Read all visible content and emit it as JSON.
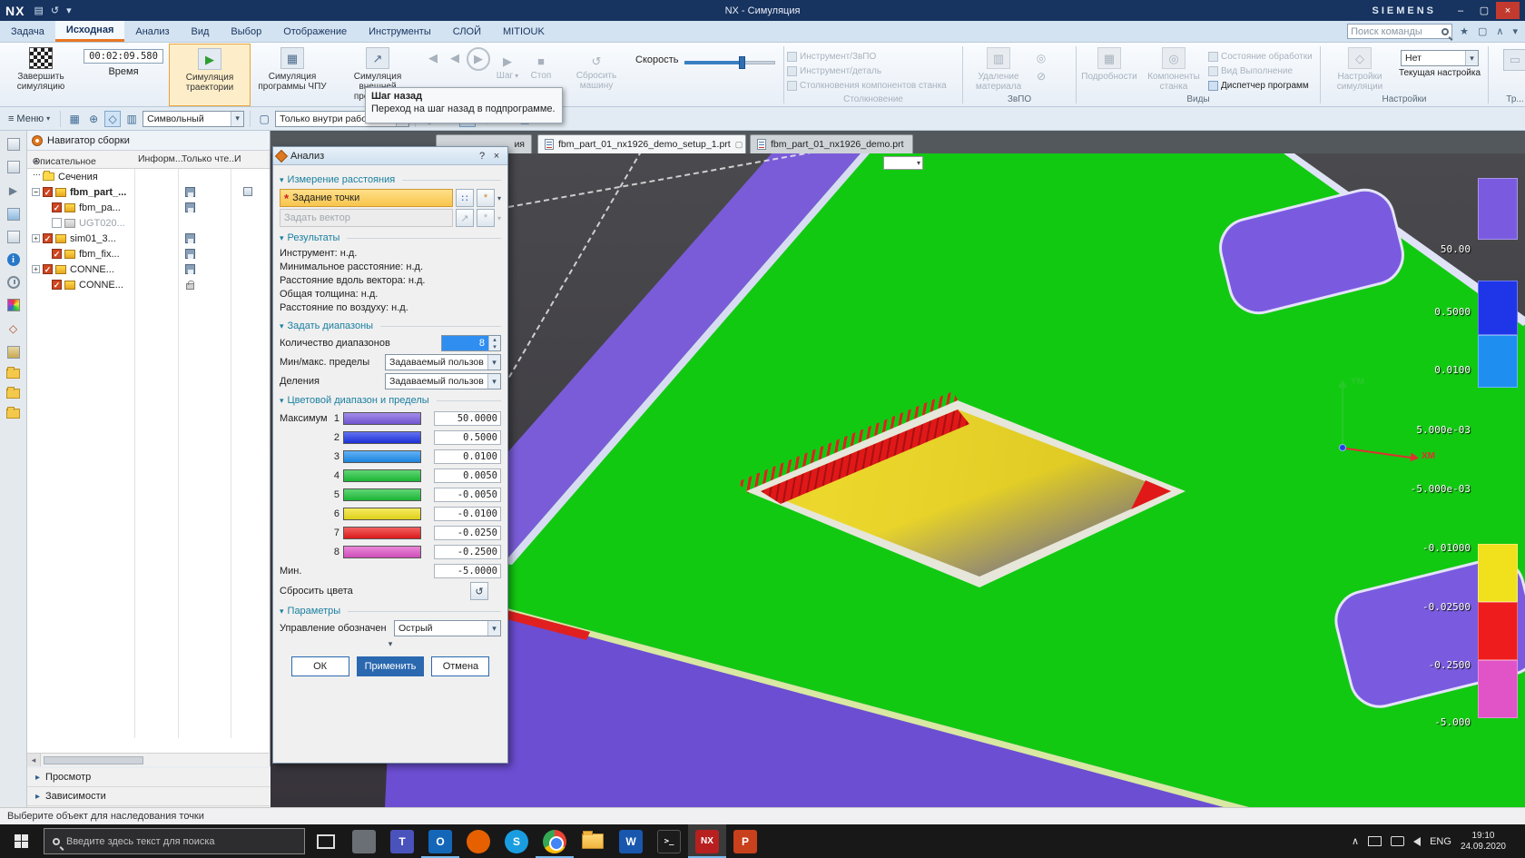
{
  "icons": {
    "dropdown": "▾",
    "spin_up": "▴",
    "spin_down": "▾",
    "menu": "≡",
    "close": "×",
    "help": "?",
    "minimize": "–",
    "restore": "▢",
    "play": "▶",
    "back": "◀",
    "stop": "■",
    "check": "✓",
    "sort_asc": "▲",
    "collapse_left": "◂",
    "section_arrow": "▾",
    "expand_row": "▸",
    "reset": "↺",
    "asterisk": "*",
    "chevron_up": "∧",
    "minus": "−",
    "plus": "+",
    "save": "▤",
    "undo": "↺",
    "star": "★",
    "window": "▢",
    "grid": "▦",
    "dots": "∷",
    "vector": "↗",
    "cells": "▥",
    "target": "◎",
    "slash": "⊘",
    "plus_circle": "⊕",
    "diamond": "◇",
    "rect": "▭",
    "prompt": "&gt;_"
  },
  "titlebar": {
    "logo": "NX",
    "title": "NX - Симуляция",
    "brand": "SIEMENS"
  },
  "menubar": {
    "tabs": [
      {
        "label": "Задача"
      },
      {
        "label": "Исходная"
      },
      {
        "label": "Анализ"
      },
      {
        "label": "Вид"
      },
      {
        "label": "Выбор"
      },
      {
        "label": "Отображение"
      },
      {
        "label": "Инструменты"
      },
      {
        "label": "СЛОЙ"
      },
      {
        "label": "MITIOUK"
      }
    ],
    "search_placeholder": "Поиск команды"
  },
  "ribbon": {
    "finish_label": "Завершить симуляцию",
    "time_value": "00:02:09.580",
    "time_label": "Время",
    "sim_traj_label": "Симуляция траектории",
    "sim_cnc_label": "Симуляция программы ЧПУ",
    "sim_ext_label": "Симуляция внешней программы",
    "step_label": "Шаг",
    "stop_label": "Стоп",
    "reset_machine_label": "Сбросить машину",
    "speed_label": "Скорость",
    "collision": {
      "items": [
        "Инструмент/ЗвПО",
        "Инструмент/деталь",
        "Столкновения компонентов станка"
      ],
      "label": "Столкновение"
    },
    "ivs": {
      "removal_label": "Удаление материала",
      "label": "ЗвПО"
    },
    "views": {
      "details_label": "Подробности",
      "machine_label": "Компоненты станка",
      "items": [
        "Состояние обработки",
        "Вид Выполнение",
        "Диспетчер программ"
      ],
      "label": "Виды"
    },
    "settings": {
      "sim_settings_label": "Настройки симуляции",
      "none_value": "Нет",
      "current_label": "Текущая настройка",
      "label": "Настройки"
    },
    "tr": {
      "label": "Тр..."
    }
  },
  "tooltip": {
    "title": "Шаг назад",
    "text": "Переход на шаг назад в подпрограмме."
  },
  "toolbar2": {
    "menu_label": "Меню",
    "type_combo_value": "Символьный",
    "scope_combo_value": "Только внутри рабоч..."
  },
  "navigator": {
    "title": "Навигатор сборки",
    "columns": [
      "Описательное ...",
      "Информ...",
      "Только чте...",
      "И"
    ],
    "rows": [
      {
        "label": "Сечения"
      },
      {
        "label": "fbm_part_..."
      },
      {
        "label": "fbm_pa..."
      },
      {
        "label": "UGT020..."
      },
      {
        "label": "sim01_3..."
      },
      {
        "label": "fbm_fix..."
      },
      {
        "label": "CONNE..."
      },
      {
        "label": "CONNE..."
      }
    ]
  },
  "bottom_sections": {
    "s1": "Просмотр",
    "s2": "Зависимости"
  },
  "dialog": {
    "title": "Анализ",
    "s1": "Измерение расстояния",
    "point_label": "Задание точки",
    "vector_label": "Задать вектор",
    "s2": "Результаты",
    "results": [
      "Инструмент: н.д.",
      "Минимальное расстояние: н.д.",
      "Расстояние вдоль вектора: н.д.",
      "Общая толщина: н.д.",
      "Расстояние по воздуху: н.д."
    ],
    "s3": "Задать диапазоны",
    "ranges_count_label": "Количество диапазонов",
    "ranges_count_value": "8",
    "minmax_label": "Мин/макс. пределы",
    "minmax_value": "Задаваемый пользов",
    "divisions_label": "Деления",
    "divisions_value": "Задаваемый пользов",
    "s4": "Цветовой диапазон и пределы",
    "max_label": "Максимум",
    "color_rows": [
      {
        "n": "1",
        "color": "#7a5be0",
        "value": "50.0000"
      },
      {
        "n": "2",
        "color": "#1f35e8",
        "value": "0.5000"
      },
      {
        "n": "3",
        "color": "#1e8ff0",
        "value": "0.0100"
      },
      {
        "n": "4",
        "color": "#1dc43a",
        "value": "0.0050"
      },
      {
        "n": "5",
        "color": "#1dc43a",
        "value": "-0.0050"
      },
      {
        "n": "6",
        "color": "#f0e11c",
        "value": "-0.0100"
      },
      {
        "n": "7",
        "color": "#ee1c1c",
        "value": "-0.0250"
      },
      {
        "n": "8",
        "color": "#e054c8",
        "value": "-0.2500"
      }
    ],
    "min_label": "Мин.",
    "min_value": "-5.0000",
    "reset_colors_label": "Сбросить цвета",
    "s5": "Параметры",
    "marker_label": "Управление обозначен",
    "marker_value": "Острый",
    "ok": "ОК",
    "apply": "Применить",
    "cancel": "Отмена"
  },
  "file_tabs": {
    "partial": "ия",
    "active": "fbm_part_01_nx1926_demo_setup_1.prt",
    "other": "fbm_part_01_nx1926_demo.prt"
  },
  "viewport": {
    "legend_labels": [
      "50.00",
      "0.5000",
      "0.0100",
      "5.000e-03",
      "-5.000e-03",
      "-0.01000",
      "-0.02500",
      "-0.2500",
      "-5.000"
    ],
    "legend_colors": [
      "#7a5be0",
      "#1f35e8",
      "#1e8ff0",
      "#f0e11c",
      "#ee1c1c",
      "#e054c8"
    ],
    "axis_y_label": "YM",
    "axis_x_label": "XM"
  },
  "scene_colors": {
    "green": "#12c912",
    "purple_side": "#7a5cd8",
    "purple_bottom": "#6c4ed2",
    "pocket_purple": "#7a5be0"
  },
  "statusbar": {
    "message": "Выберите объект для наследования точки"
  },
  "taskbar": {
    "search_placeholder": "Введите здесь текст для поиска",
    "language": "ENG",
    "time": "19:10",
    "date": "24.09.2020",
    "apps": [
      {
        "glyph": "",
        "color": "#6a6f75"
      },
      {
        "glyph": "T",
        "color": "#4a53bc"
      },
      {
        "glyph": "O",
        "color": "#1467b8"
      },
      {
        "glyph": "",
        "color": "#e66000"
      },
      {
        "glyph": "S",
        "color": "#1a9de0"
      },
      {
        "glyph": "",
        "color": "#ffffff"
      },
      {
        "glyph": "",
        "color": "#f2c14a"
      },
      {
        "glyph": "W",
        "color": "#1857ad"
      },
      {
        "glyph": ">_",
        "color": "#1c1c1c"
      },
      {
        "glyph": "NX",
        "color": "#b82020"
      },
      {
        "glyph": "P",
        "color": "#c8401c"
      }
    ]
  }
}
